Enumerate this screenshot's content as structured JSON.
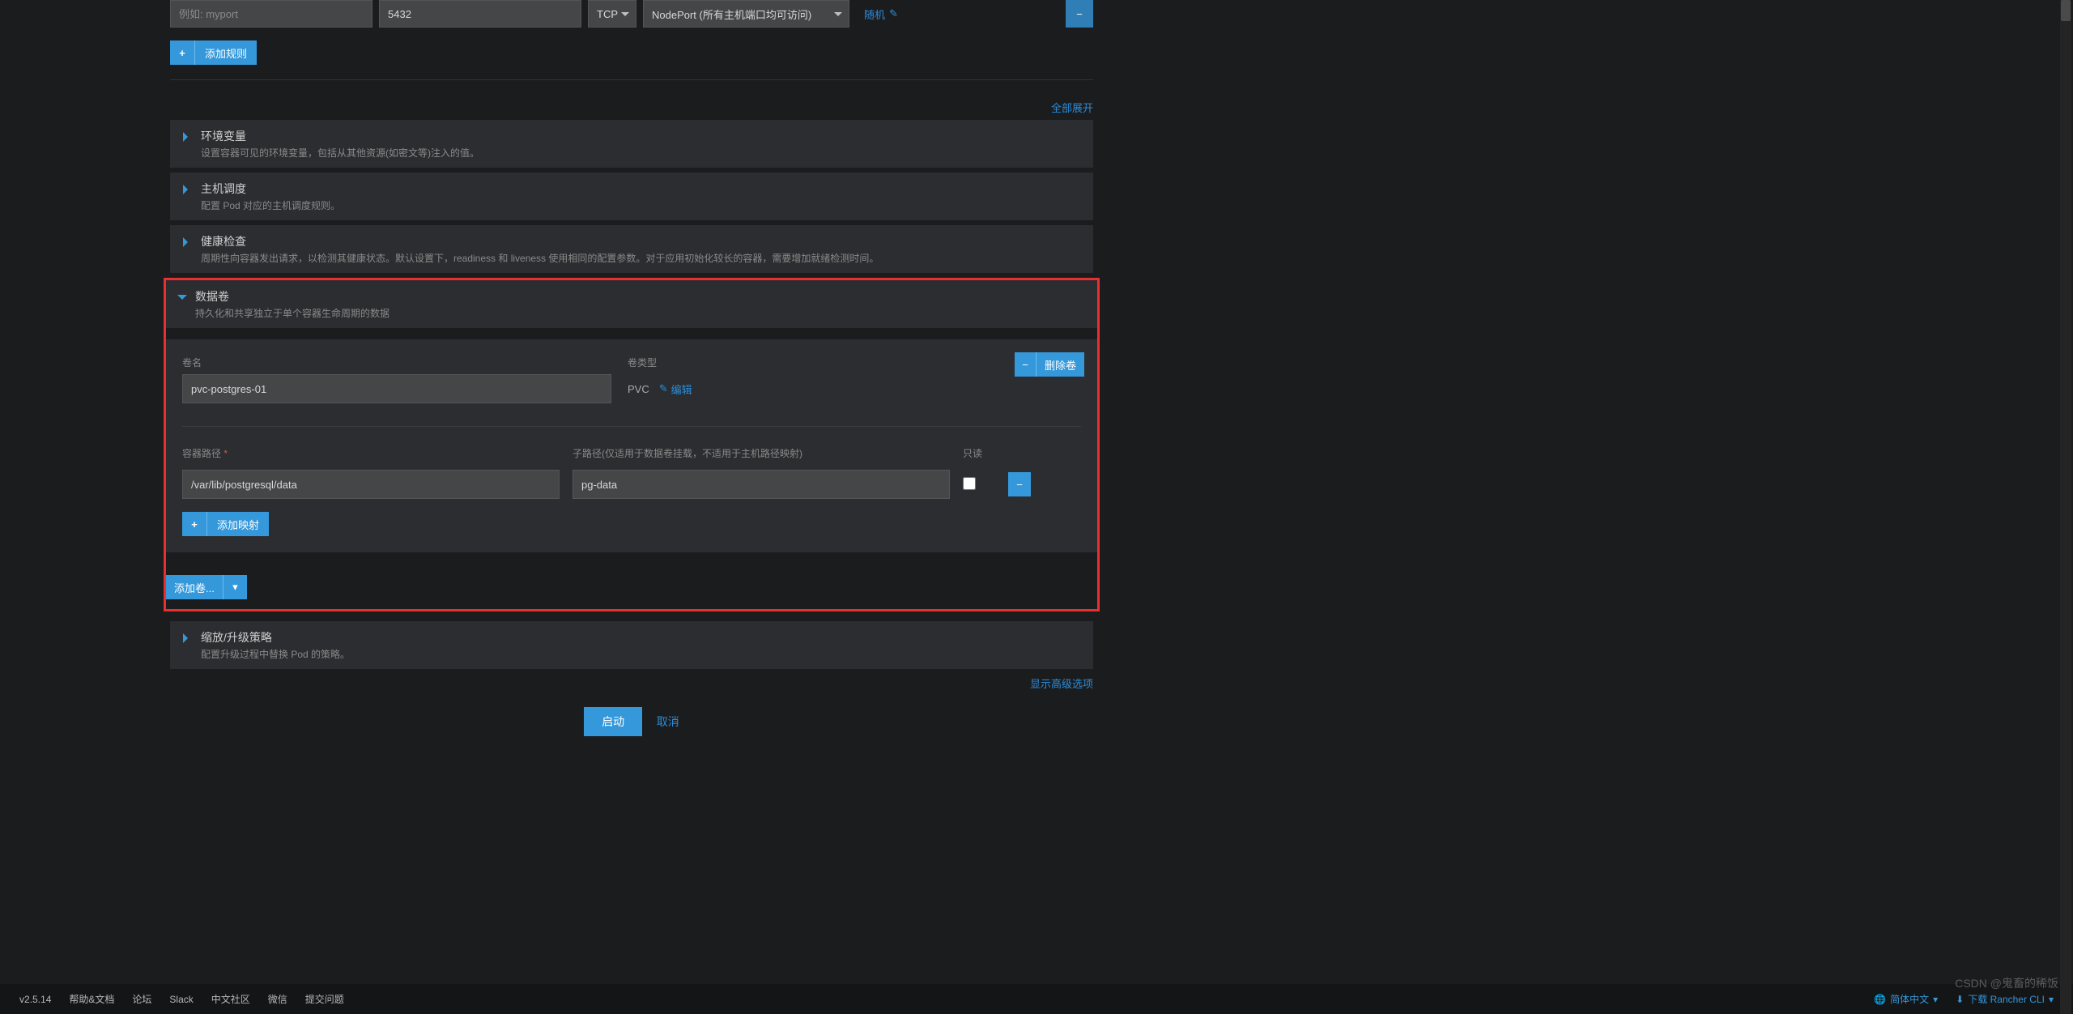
{
  "ports": {
    "name_placeholder": "例如: myport",
    "port_value": "5432",
    "protocol": "TCP",
    "access_mode": "NodePort (所有主机端口均可访问)",
    "random_label": "随机",
    "add_rule": "添加规则"
  },
  "expand_all": "全部展开",
  "sections": {
    "env": {
      "title": "环境变量",
      "desc": "设置容器可见的环境变量，包括从其他资源(如密文等)注入的值。"
    },
    "scheduling": {
      "title": "主机调度",
      "desc": "配置 Pod 对应的主机调度规则。"
    },
    "health": {
      "title": "健康检查",
      "desc": "周期性向容器发出请求，以检测其健康状态。默认设置下，readiness 和 liveness 使用相同的配置参数。对于应用初始化较长的容器，需要增加就绪检测时间。"
    },
    "volumes": {
      "title": "数据卷",
      "desc": "持久化和共享独立于单个容器生命周期的数据"
    },
    "scale": {
      "title": "缩放/升级策略",
      "desc": "配置升级过程中替换 Pod 的策略。"
    }
  },
  "volume": {
    "name_label": "卷名",
    "name_value": "pvc-postgres-01",
    "type_label": "卷类型",
    "type_value": "PVC",
    "edit_label": "编辑",
    "delete_label": "删除卷",
    "path_label": "容器路径",
    "subpath_label": "子路径(仅适用于数据卷挂载，不适用于主机路径映射)",
    "readonly_label": "只读",
    "path_value": "/var/lib/postgresql/data",
    "subpath_value": "pg-data",
    "add_mount": "添加映射",
    "add_volume": "添加卷..."
  },
  "adv_options": "显示高级选项",
  "launch": "启动",
  "cancel": "取消",
  "footer": {
    "version": "v2.5.14",
    "help": "帮助&文档",
    "forum": "论坛",
    "slack": "Slack",
    "cn_community": "中文社区",
    "wechat": "微信",
    "issue": "提交问题",
    "lang": "简体中文",
    "download": "下载 Rancher CLI"
  },
  "watermark": "CSDN @鬼畜的稀饭"
}
